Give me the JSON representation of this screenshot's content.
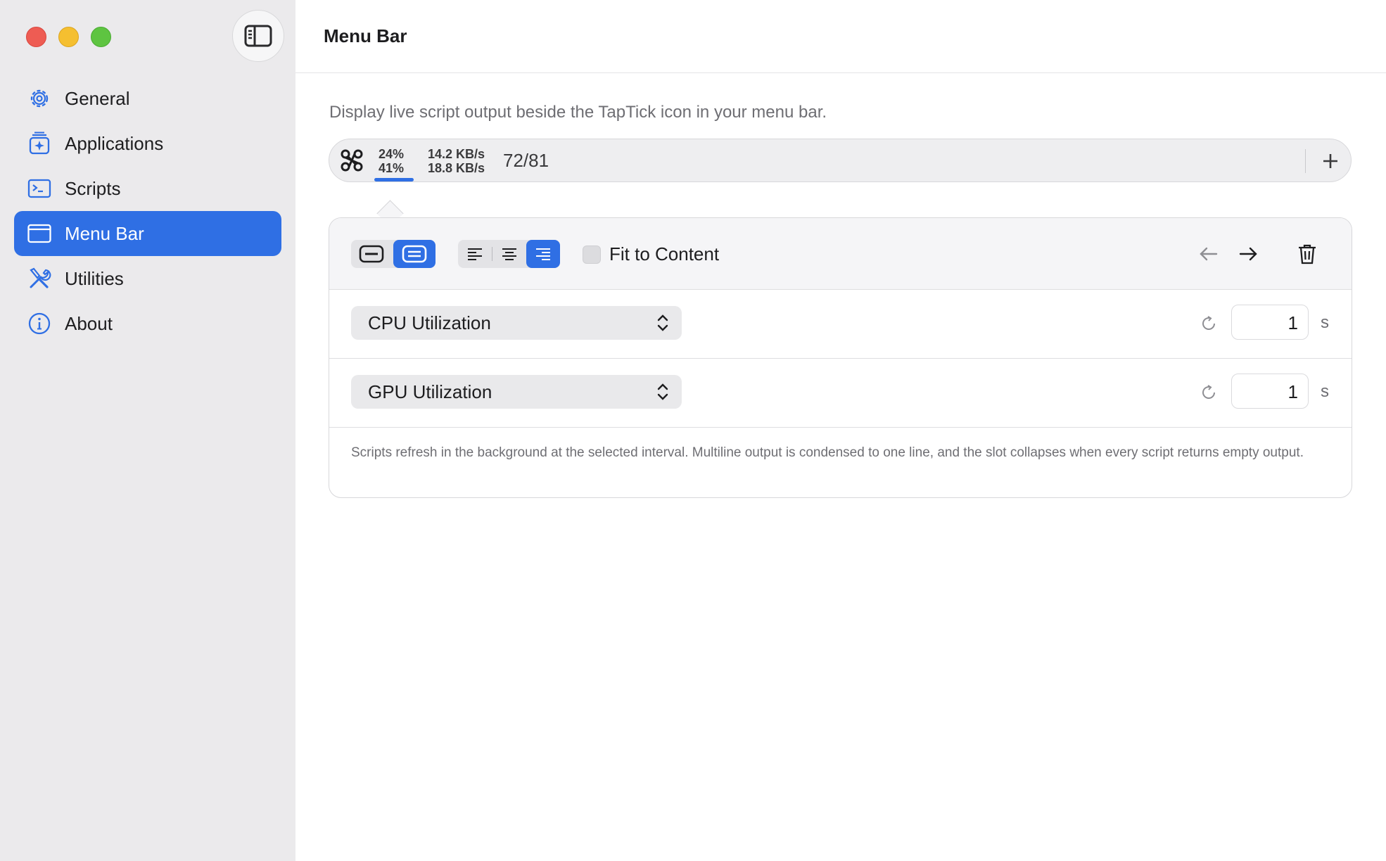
{
  "sidebar": {
    "items": [
      {
        "label": "General",
        "icon": "gear-icon"
      },
      {
        "label": "Applications",
        "icon": "applications-icon"
      },
      {
        "label": "Scripts",
        "icon": "terminal-icon"
      },
      {
        "label": "Menu Bar",
        "icon": "menubar-window-icon",
        "selected": true
      },
      {
        "label": "Utilities",
        "icon": "tools-icon"
      },
      {
        "label": "About",
        "icon": "info-icon"
      }
    ]
  },
  "header": {
    "title": "Menu Bar"
  },
  "main": {
    "description": "Display live script output beside the TapTick icon in your menu bar.",
    "preview": {
      "icon": "command-icon",
      "cpu_line1": "24%",
      "cpu_line2": "41%",
      "net_line1": "14.2 KB/s",
      "net_line2": "18.8 KB/s",
      "ratio": "72/81",
      "add_icon": "plus-icon"
    },
    "editor": {
      "fit_to_content_label": "Fit to Content",
      "fit_to_content_checked": false,
      "layout_selected": "two-line",
      "alignment_selected": "right",
      "rows": [
        {
          "script": "CPU Utilization",
          "interval": "1",
          "unit": "s"
        },
        {
          "script": "GPU Utilization",
          "interval": "1",
          "unit": "s"
        }
      ],
      "footnote": "Scripts refresh in the background at the selected interval. Multiline output is condensed to one line, and the slot collapses when every script returns empty output."
    }
  },
  "colors": {
    "accent": "#2f6fe4",
    "sidebar_bg": "#ebeaec",
    "close": "#ee5c53",
    "minimize": "#f5bf30",
    "maximize": "#5ec441"
  }
}
